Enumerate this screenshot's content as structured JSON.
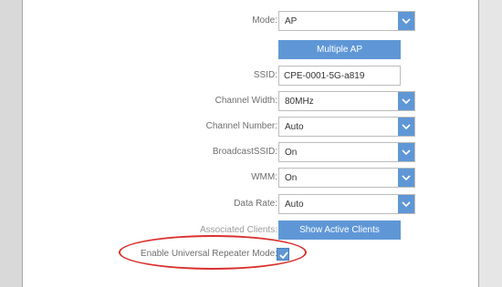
{
  "form": {
    "mode": {
      "label": "Mode:",
      "value": "AP"
    },
    "multiple_ap_button": "Multiple AP",
    "ssid": {
      "label": "SSID:",
      "value": "CPE-0001-5G-a819"
    },
    "channel_width": {
      "label": "Channel Width:",
      "value": "80MHz"
    },
    "channel_number": {
      "label": "Channel Number:",
      "value": "Auto"
    },
    "broadcast_ssid": {
      "label": "BroadcastSSID:",
      "value": "On"
    },
    "wmm": {
      "label": "WMM:",
      "value": "On"
    },
    "data_rate": {
      "label": "Data Rate:",
      "value": "Auto"
    },
    "associated_clients": {
      "label": "Associated Clients:",
      "button": "Show Active Clients"
    },
    "universal_repeater": {
      "label": "Enable Universal Repeater Mode:",
      "checked": true
    }
  },
  "colors": {
    "accent": "#5f97d6",
    "highlight_ellipse": "#d9302e"
  },
  "icons": {
    "dropdown": "chevron-down-icon",
    "check": "checkmark-icon"
  }
}
